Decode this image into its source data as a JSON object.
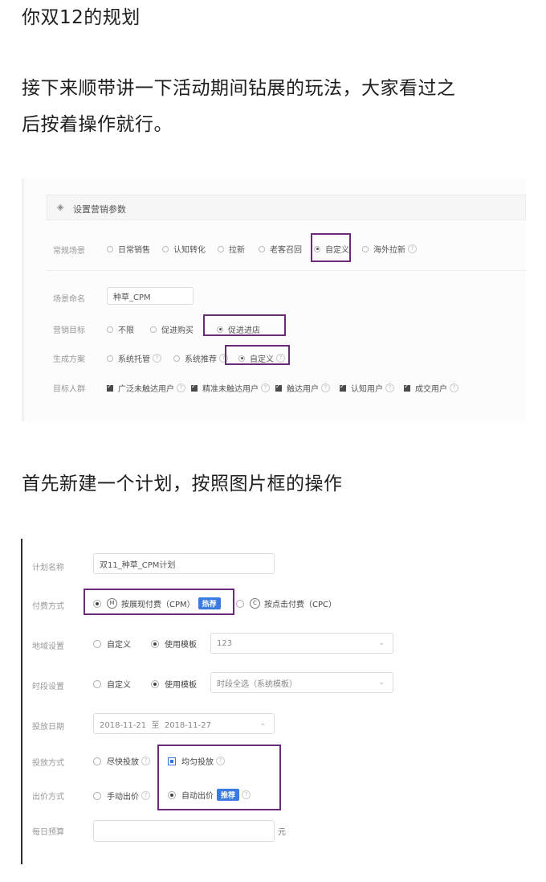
{
  "article": {
    "line1": "你双12的规划",
    "para2_line1": "接下来顺带讲一下活动期间钻展的玩法，大家看过之",
    "para2_line2": "后按着操作就行。",
    "para3": "首先新建一个计划，按照图片框的操作"
  },
  "screenshot1": {
    "header_icon": "layers-icon",
    "header_title": "设置营销参数",
    "scene_label": "常规场景",
    "scene_options": [
      "日常销售",
      "认知转化",
      "拉新",
      "老客召回",
      "自定义",
      "海外拉新"
    ],
    "scene_selected": "自定义",
    "name_label": "场景命名",
    "name_value": "种草_CPM",
    "goal_label": "营销目标",
    "goal_options": [
      "不限",
      "促进购买",
      "促进进店"
    ],
    "goal_selected": "促进进店",
    "plan_label": "生成方案",
    "plan_options": [
      "系统托管",
      "系统推荐",
      "自定义"
    ],
    "plan_selected": "自定义",
    "crowd_label": "目标人群",
    "crowd_options": [
      "广泛未触达用户",
      "精准未触达用户",
      "触达用户",
      "认知用户",
      "成交用户"
    ]
  },
  "screenshot2": {
    "plan_name_label": "计划名称",
    "plan_name_value": "双11_种草_CPM计划",
    "pay_label": "付费方式",
    "pay_cpm_letter": "M",
    "pay_cpm": "按展现付费（CPM）",
    "pay_cpm_badge": "热荐",
    "pay_cpc_letter": "C",
    "pay_cpc": "按点击付费（CPC）",
    "region_label": "地域设置",
    "region_custom": "自定义",
    "region_template": "使用模板",
    "region_select": "123",
    "time_label": "时段设置",
    "time_custom": "自定义",
    "time_template": "使用模板",
    "time_select": "时段全选（系统模板）",
    "date_label": "投放日期",
    "date_start": "2018-11-21",
    "date_to": "至",
    "date_end": "2018-11-27",
    "delivery_label": "投放方式",
    "delivery_fast": "尽快投放",
    "delivery_even": "均匀投放",
    "bid_label": "出价方式",
    "bid_manual": "手动出价",
    "bid_auto": "自动出价",
    "bid_auto_badge": "推荐",
    "budget_label": "每日预算",
    "budget_unit": "元"
  },
  "colors": {
    "highlight_border": "#6a2a7a",
    "badge_blue": "#3b7be0"
  }
}
